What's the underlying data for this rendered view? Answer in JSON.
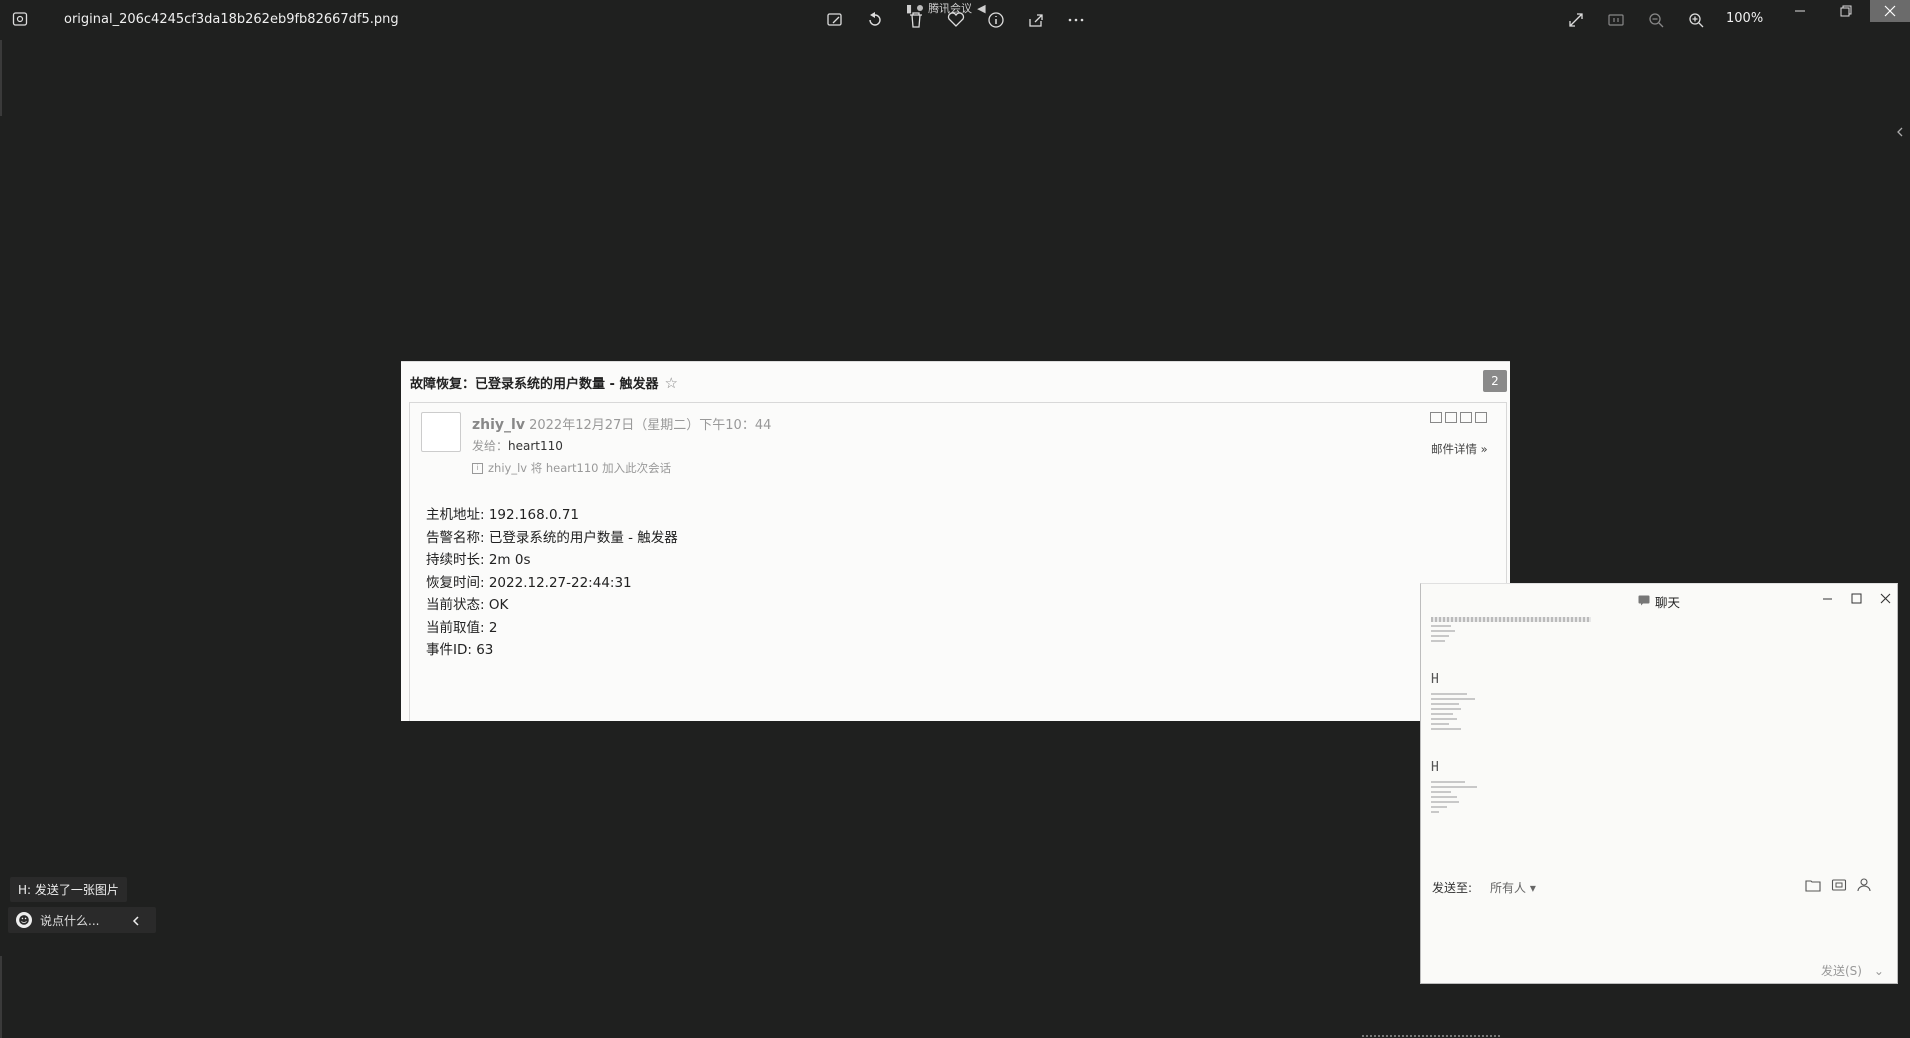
{
  "viewer": {
    "filename": "original_206c4245cf3da18b262eb9fb82667df5.png",
    "zoom": "100%",
    "meeting": "腾讯会议"
  },
  "email": {
    "subject": "故障恢复：已登录系统的用户数量 - 触发器",
    "badge": "2",
    "sender_name": "zhiy_lv",
    "sent_time": "2022年12月27日（星期二）下午10：44",
    "to_label": "发给：",
    "to_value": "heart110",
    "join_note": "zhiy_lv 将 heart110 加入此次会话",
    "details_label": "邮件详情",
    "lines": [
      "主机地址: 192.168.0.71",
      "告警名称: 已登录系统的用户数量 - 触发器",
      "持续时长: 2m 0s",
      "恢复时间: 2022.12.27-22:44:31",
      "当前状态: OK",
      "当前取值: 2",
      "事件ID: 63"
    ]
  },
  "chat": {
    "title": "聊天",
    "msg_initial_1": "H",
    "msg_initial_2": "H",
    "send_to_label": "发送至:",
    "recipient": "所有人",
    "send_button": "发送(S)"
  },
  "overlay": {
    "last_message": "H: 发送了一张图片",
    "input_placeholder": "说点什么..."
  }
}
